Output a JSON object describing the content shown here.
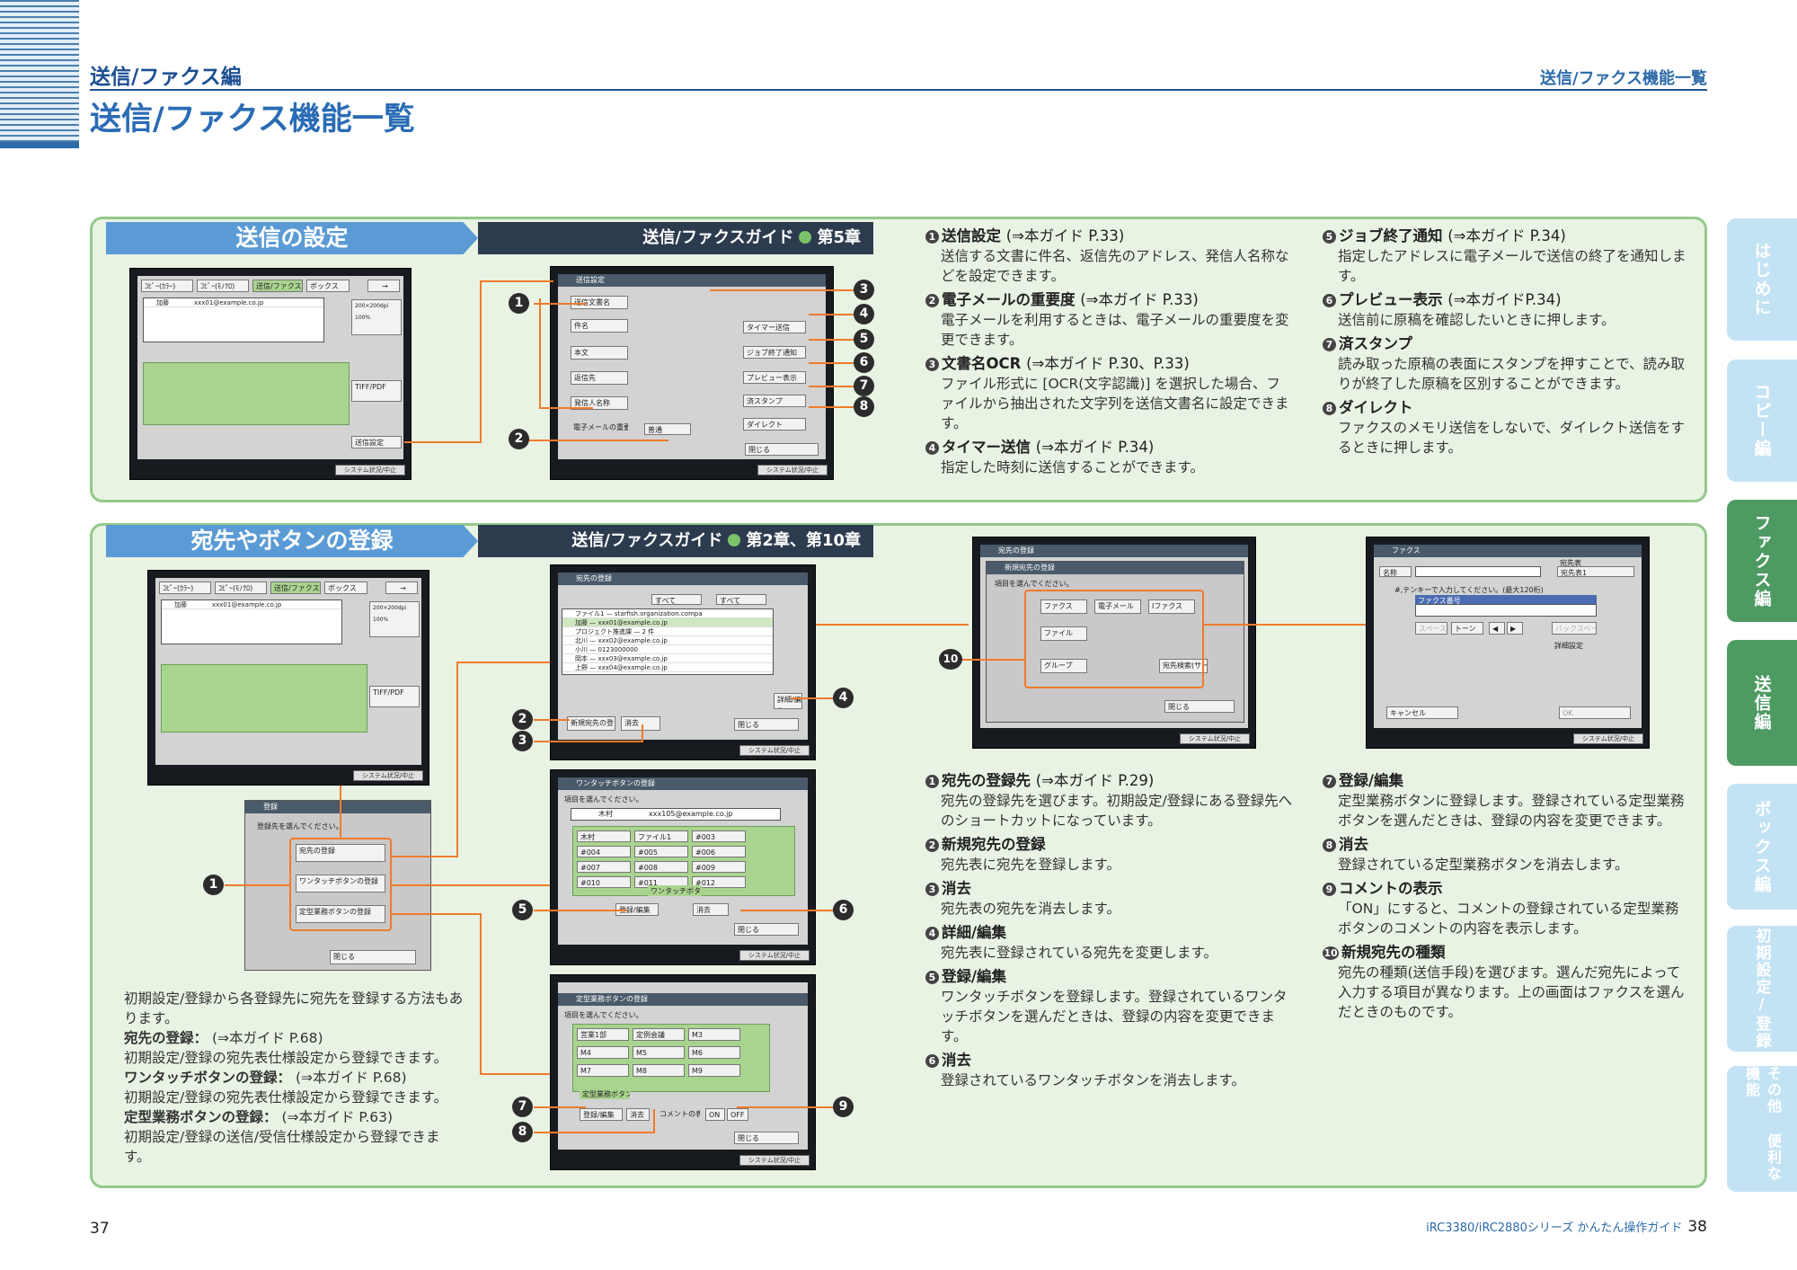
{
  "header": {
    "section": "送信/ファクス編",
    "right": "送信/ファクス機能一覧",
    "title": "送信/ファクス機能一覧"
  },
  "panel1": {
    "title": "送信の設定",
    "guide": "送信/ファクスガイド",
    "chapter": "第5章",
    "items": [
      {
        "n": "1",
        "head": "送信設定",
        "ref": "(⇒本ガイド P.33)",
        "body": "送信する文書に件名、返信先のアドレス、発信人名称などを設定できます。"
      },
      {
        "n": "2",
        "head": "電子メールの重要度",
        "ref": "(⇒本ガイド P.33)",
        "body": "電子メールを利用するときは、電子メールの重要度を変更できます。"
      },
      {
        "n": "3",
        "head": "文書名OCR",
        "ref": "(⇒本ガイド P.30、P.33)",
        "body": "ファイル形式に [OCR(文字認識)] を選択した場合、ファイルから抽出された文字列を送信文書名に設定できます。"
      },
      {
        "n": "4",
        "head": "タイマー送信",
        "ref": "(⇒本ガイド P.34)",
        "body": "指定した時刻に送信することができます。"
      },
      {
        "n": "5",
        "head": "ジョブ終了通知",
        "ref": "(⇒本ガイド P.34)",
        "body": "指定したアドレスに電子メールで送信の終了を通知します。"
      },
      {
        "n": "6",
        "head": "プレビュー表示",
        "ref": "(⇒本ガイドP.34)",
        "body": "送信前に原稿を確認したいときに押します。"
      },
      {
        "n": "7",
        "head": "済スタンプ",
        "ref": "",
        "body": "読み取った原稿の表面にスタンプを押すことで、読み取りが終了した原稿を区別することができます。"
      },
      {
        "n": "8",
        "head": "ダイレクト",
        "ref": "",
        "body": "ファクスのメモリ送信をしないで、ダイレクト送信をするときに押します。"
      }
    ]
  },
  "panel2": {
    "title": "宛先やボタンの登録",
    "guide": "送信/ファクスガイド",
    "chapter": "第2章、第10章",
    "intro": "初期設定/登録から各登録先に宛先を登録する方法もあります。",
    "regs": [
      {
        "head": "宛先の登録：",
        "ref": "(⇒本ガイド P.68)",
        "body": "初期設定/登録の宛先表仕様設定から登録できます。"
      },
      {
        "head": "ワンタッチボタンの登録：",
        "ref": "(⇒本ガイド P.68)",
        "body": "初期設定/登録の宛先表仕様設定から登録できます。"
      },
      {
        "head": "定型業務ボタンの登録：",
        "ref": "(⇒本ガイド P.63)",
        "body": "初期設定/登録の送信/受信仕様設定から登録できます。"
      }
    ],
    "items": [
      {
        "n": "1",
        "head": "宛先の登録先",
        "ref": "(⇒本ガイド P.29)",
        "body": "宛先の登録先を選びます。初期設定/登録にある登録先へのショートカットになっています。"
      },
      {
        "n": "2",
        "head": "新規宛先の登録",
        "ref": "",
        "body": "宛先表に宛先を登録します。"
      },
      {
        "n": "3",
        "head": "消去",
        "ref": "",
        "body": "宛先表の宛先を消去します。"
      },
      {
        "n": "4",
        "head": "詳細/編集",
        "ref": "",
        "body": "宛先表に登録されている宛先を変更します。"
      },
      {
        "n": "5",
        "head": "登録/編集",
        "ref": "",
        "body": "ワンタッチボタンを登録します。登録されているワンタッチボタンを選んだときは、登録の内容を変更できます。"
      },
      {
        "n": "6",
        "head": "消去",
        "ref": "",
        "body": "登録されているワンタッチボタンを消去します。"
      },
      {
        "n": "7",
        "head": "登録/編集",
        "ref": "",
        "body": "定型業務ボタンに登録します。登録されている定型業務ボタンを選んだときは、登録の内容を変更できます。"
      },
      {
        "n": "8",
        "head": "消去",
        "ref": "",
        "body": "登録されている定型業務ボタンを消去します。"
      },
      {
        "n": "9",
        "head": "コメントの表示",
        "ref": "",
        "body": "「ON」にすると、コメントの登録されている定型業務ボタンのコメントの内容を表示します。"
      },
      {
        "n": "10",
        "head": "新規宛先の種類",
        "ref": "",
        "body": "宛先の種類(送信手段)を選びます。選んだ宛先によって入力する項目が異なります。上の画面はファクスを選んだときのものです。"
      }
    ]
  },
  "screens": {
    "tabs": [
      "ｺﾋﾟｰ(ｶﾗｰ)",
      "ｺﾋﾟｰ(ﾓﾉｸﾛ)",
      "送信/ファクス",
      "ボックス",
      "→"
    ],
    "address_list": [
      {
        "name": "加藤",
        "addr": "xxx01@example.co.jp"
      }
    ],
    "send_settings": {
      "title": "送信設定",
      "fields": [
        "送信文書名",
        "件名",
        "本文",
        "返信先",
        "発信人名称",
        "電子メールの重要度"
      ],
      "importance": "普通",
      "right_btns": [
        "文書名OCR",
        "タイマー送信",
        "ジョブ終了通知",
        "プレビュー表示",
        "済スタンプ",
        "ダイレクト"
      ],
      "close": "閉じる"
    },
    "addrbook": {
      "title": "宛先の登録",
      "rows": [
        "ファイル1",
        "加藤",
        "プロジェクト推進課",
        "北川",
        "小川",
        "岡本",
        "上野"
      ],
      "addrs": [
        "starfish.organization.compa",
        "xxx01@example.co.jp",
        "2 件",
        "xxx02@example.co.jp",
        "0123000000",
        "xxx03@example.co.jp",
        "xxx04@example.co.jp"
      ],
      "new_btn": "新規宛先の登録",
      "del_btn": "消去",
      "edit_btn": "詳細/編集",
      "close": "閉じる",
      "sel1": "すべて",
      "sel2": "すべて"
    },
    "register": {
      "title": "登録",
      "prompt": "登録先を選んでください。",
      "opts": [
        "宛先の登録",
        "ワンタッチボタンの登録",
        "定型業務ボタンの登録"
      ],
      "close": "閉じる"
    },
    "onetouch": {
      "title": "ワンタッチボタンの登録",
      "prompt": "項目を選んでください。",
      "name": "木村",
      "addr": "xxx105@example.co.jp",
      "btns": [
        "木村",
        "ファイル1",
        "#003",
        "#004",
        "#005",
        "#006",
        "#007",
        "#008",
        "#009",
        "#010",
        "#011",
        "#012"
      ],
      "label": "ワンタッチボタン",
      "reg": "登録/編集",
      "del": "消去",
      "close": "閉じる"
    },
    "favorite": {
      "title": "定型業務ボタンの登録",
      "prompt": "項目を選んでください。",
      "btns": [
        "営業1部",
        "定例会議",
        "M3",
        "M4",
        "M5",
        "M6",
        "M7",
        "M8",
        "M9"
      ],
      "label": "定型業務ボタン",
      "reg": "登録/編集",
      "del": "消去",
      "comment": "コメントの表示",
      "on": "ON",
      "off": "OFF",
      "close": "閉じる"
    },
    "newaddr": {
      "title": "宛先の登録",
      "sub": "新規宛先の登録",
      "prompt": "項目を選んでください。",
      "types": [
        "ファクス",
        "電子メール",
        "Iファクス",
        "ファイル",
        "グループ",
        "宛先検索(サーバ)"
      ],
      "close": "閉じる"
    },
    "fax": {
      "title": "ファクス",
      "name_label": "名称",
      "book_label": "宛先表",
      "book": "宛先表1",
      "hint": "#,テンキーで入力してください。(最大120桁)",
      "num_label": "ファクス番号",
      "sp_labels": [
        "スペース",
        "トーン",
        "◀",
        "▶",
        "バックスペース"
      ],
      "detail": "詳細設定",
      "cancel": "キャンセル",
      "ok": "OK"
    },
    "status": "システム状況/中止"
  },
  "tabs": [
    "はじめに",
    "コピー編",
    "ファクス編",
    "送信編",
    "ボックス編",
    "初期設定/登録",
    "その他 便利な機能"
  ],
  "footer": {
    "left": "37",
    "right_brand": "iRC3380/iRC2880シリーズ かんたん操作ガイド",
    "right_page": "38"
  }
}
